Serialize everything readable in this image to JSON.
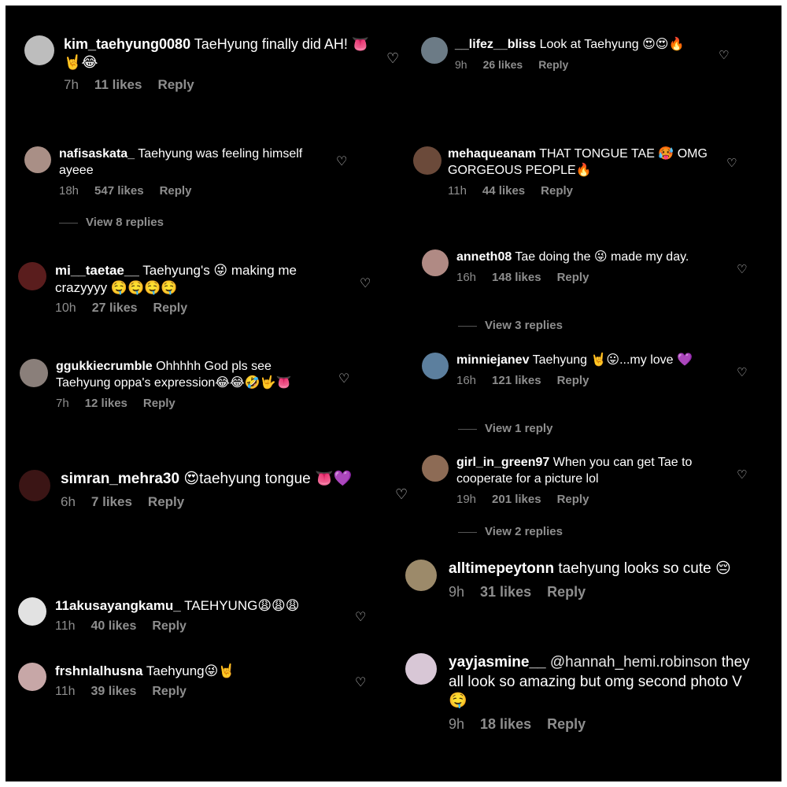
{
  "comments": [
    {
      "user": "kim_taehyung0080",
      "text": "TaeHyung finally did AH! 👅🤘😂",
      "time": "7h",
      "likes": "11 likes",
      "reply": "Reply",
      "avatar": "#bdbdbd"
    },
    {
      "user": "nafisaskata_",
      "text": "Taehyung was feeling himself ayeee",
      "time": "18h",
      "likes": "547 likes",
      "reply": "Reply",
      "avatar": "#a98f86"
    },
    {
      "user": "mi__taetae__",
      "text": "Taehyung's 😜 making me crazyyyy 🤤🤤🤤🤤",
      "time": "10h",
      "likes": "27 likes",
      "reply": "Reply",
      "avatar": "#5a1d1d"
    },
    {
      "user": "ggukkiecrumble",
      "text": "Ohhhhh God pls see Taehyung oppa's expression😂😂🤣🤟👅",
      "time": "7h",
      "likes": "12 likes",
      "reply": "Reply",
      "avatar": "#8a7f7a"
    },
    {
      "user": "simran_mehra30",
      "text": "😍taehyung tongue 👅💜",
      "time": "6h",
      "likes": "7 likes",
      "reply": "Reply",
      "avatar": "#3b1515"
    },
    {
      "user": "11akusayangkamu_",
      "text": "TAEHYUNG😩😩😩",
      "time": "11h",
      "likes": "40 likes",
      "reply": "Reply",
      "avatar": "#e2e2e2"
    },
    {
      "user": "frshnlalhusna",
      "text": "Taehyung😜🤘",
      "time": "11h",
      "likes": "39 likes",
      "reply": "Reply",
      "avatar": "#c7a7a7"
    },
    {
      "user": "__lifez__bliss",
      "text": "Look at Taehyung 😍😍🔥",
      "time": "9h",
      "likes": "26 likes",
      "reply": "Reply",
      "avatar": "#6c7b86"
    },
    {
      "user": "mehaqueanam",
      "text": "THAT TONGUE TAE 🥵 OMG GORGEOUS PEOPLE🔥",
      "time": "11h",
      "likes": "44 likes",
      "reply": "Reply",
      "avatar": "#6b4a3a"
    },
    {
      "user": "anneth08",
      "text": "Tae doing the 😜 made my day.",
      "time": "16h",
      "likes": "148 likes",
      "reply": "Reply",
      "avatar": "#b08a84"
    },
    {
      "user": "minniejanev",
      "text": "Taehyung 🤘😛...my love 💜",
      "time": "16h",
      "likes": "121 likes",
      "reply": "Reply",
      "avatar": "#5c7f9e"
    },
    {
      "user": "girl_in_green97",
      "text": "When you can get Tae to cooperate for a picture lol",
      "time": "19h",
      "likes": "201 likes",
      "reply": "Reply",
      "avatar": "#8d6b55"
    },
    {
      "user": "alltimepeytonn",
      "text": "taehyung looks so cute 😔",
      "time": "9h",
      "likes": "31 likes",
      "reply": "Reply",
      "avatar": "#9c8a6a"
    },
    {
      "user": "yayjasmine__",
      "mention": "@hannah_hemi.robinson",
      "text": "they all look so amazing but omg second photo V 🤤",
      "time": "9h",
      "likes": "18 likes",
      "reply": "Reply",
      "avatar": "#d8c7d6"
    }
  ],
  "view_replies": [
    "View 8 replies",
    "View 3 replies",
    "View 1 reply",
    "View 2 replies"
  ],
  "heart_glyph": "♡"
}
